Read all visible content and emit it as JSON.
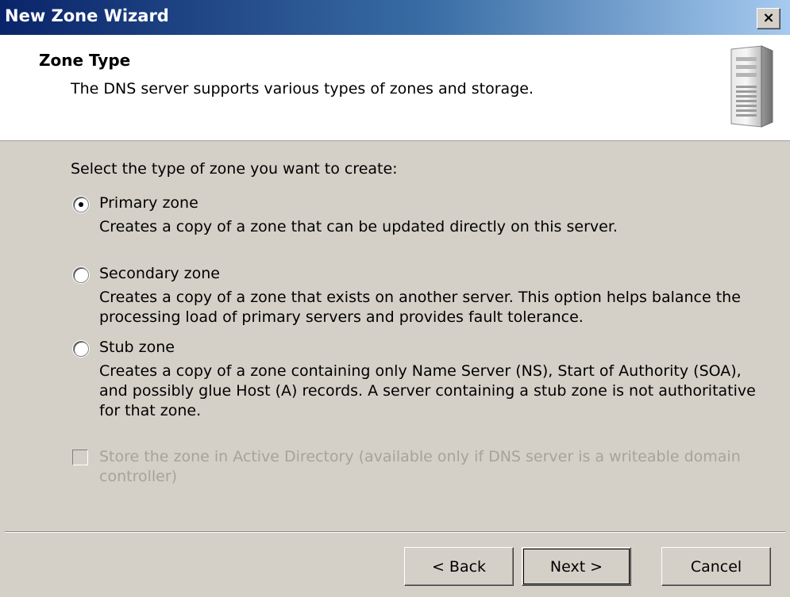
{
  "window": {
    "title": "New Zone Wizard",
    "close_label": "×"
  },
  "header": {
    "title": "Zone Type",
    "subtitle": "The DNS server supports various types of zones and storage.",
    "icon": "server-icon"
  },
  "body": {
    "prompt": "Select the type of zone you want to create:",
    "selected_option": "primary",
    "options": [
      {
        "id": "primary",
        "label": "Primary zone",
        "checked": true,
        "description": "Creates a copy of a zone that can be updated directly on this server."
      },
      {
        "id": "secondary",
        "label": "Secondary zone",
        "checked": false,
        "description": "Creates a copy of a zone that exists on another server. This option helps balance the processing load of primary servers and provides fault tolerance."
      },
      {
        "id": "stub",
        "label": "Stub zone",
        "checked": false,
        "description": "Creates a copy of a zone containing only Name Server (NS), Start of Authority (SOA), and possibly glue Host (A) records. A server containing a stub zone is not authoritative for that zone."
      }
    ],
    "store_in_ad": {
      "label": "Store the zone in Active Directory (available only if DNS server is a writeable domain controller)",
      "checked": false,
      "enabled": false
    }
  },
  "footer": {
    "back_label": "< Back",
    "next_label": "Next >",
    "cancel_label": "Cancel"
  },
  "colors": {
    "title_bar_start": "#0a246a",
    "title_bar_end": "#a6caf0",
    "dialog_face": "#d4d0c8",
    "disabled_text": "#a7a39b"
  }
}
